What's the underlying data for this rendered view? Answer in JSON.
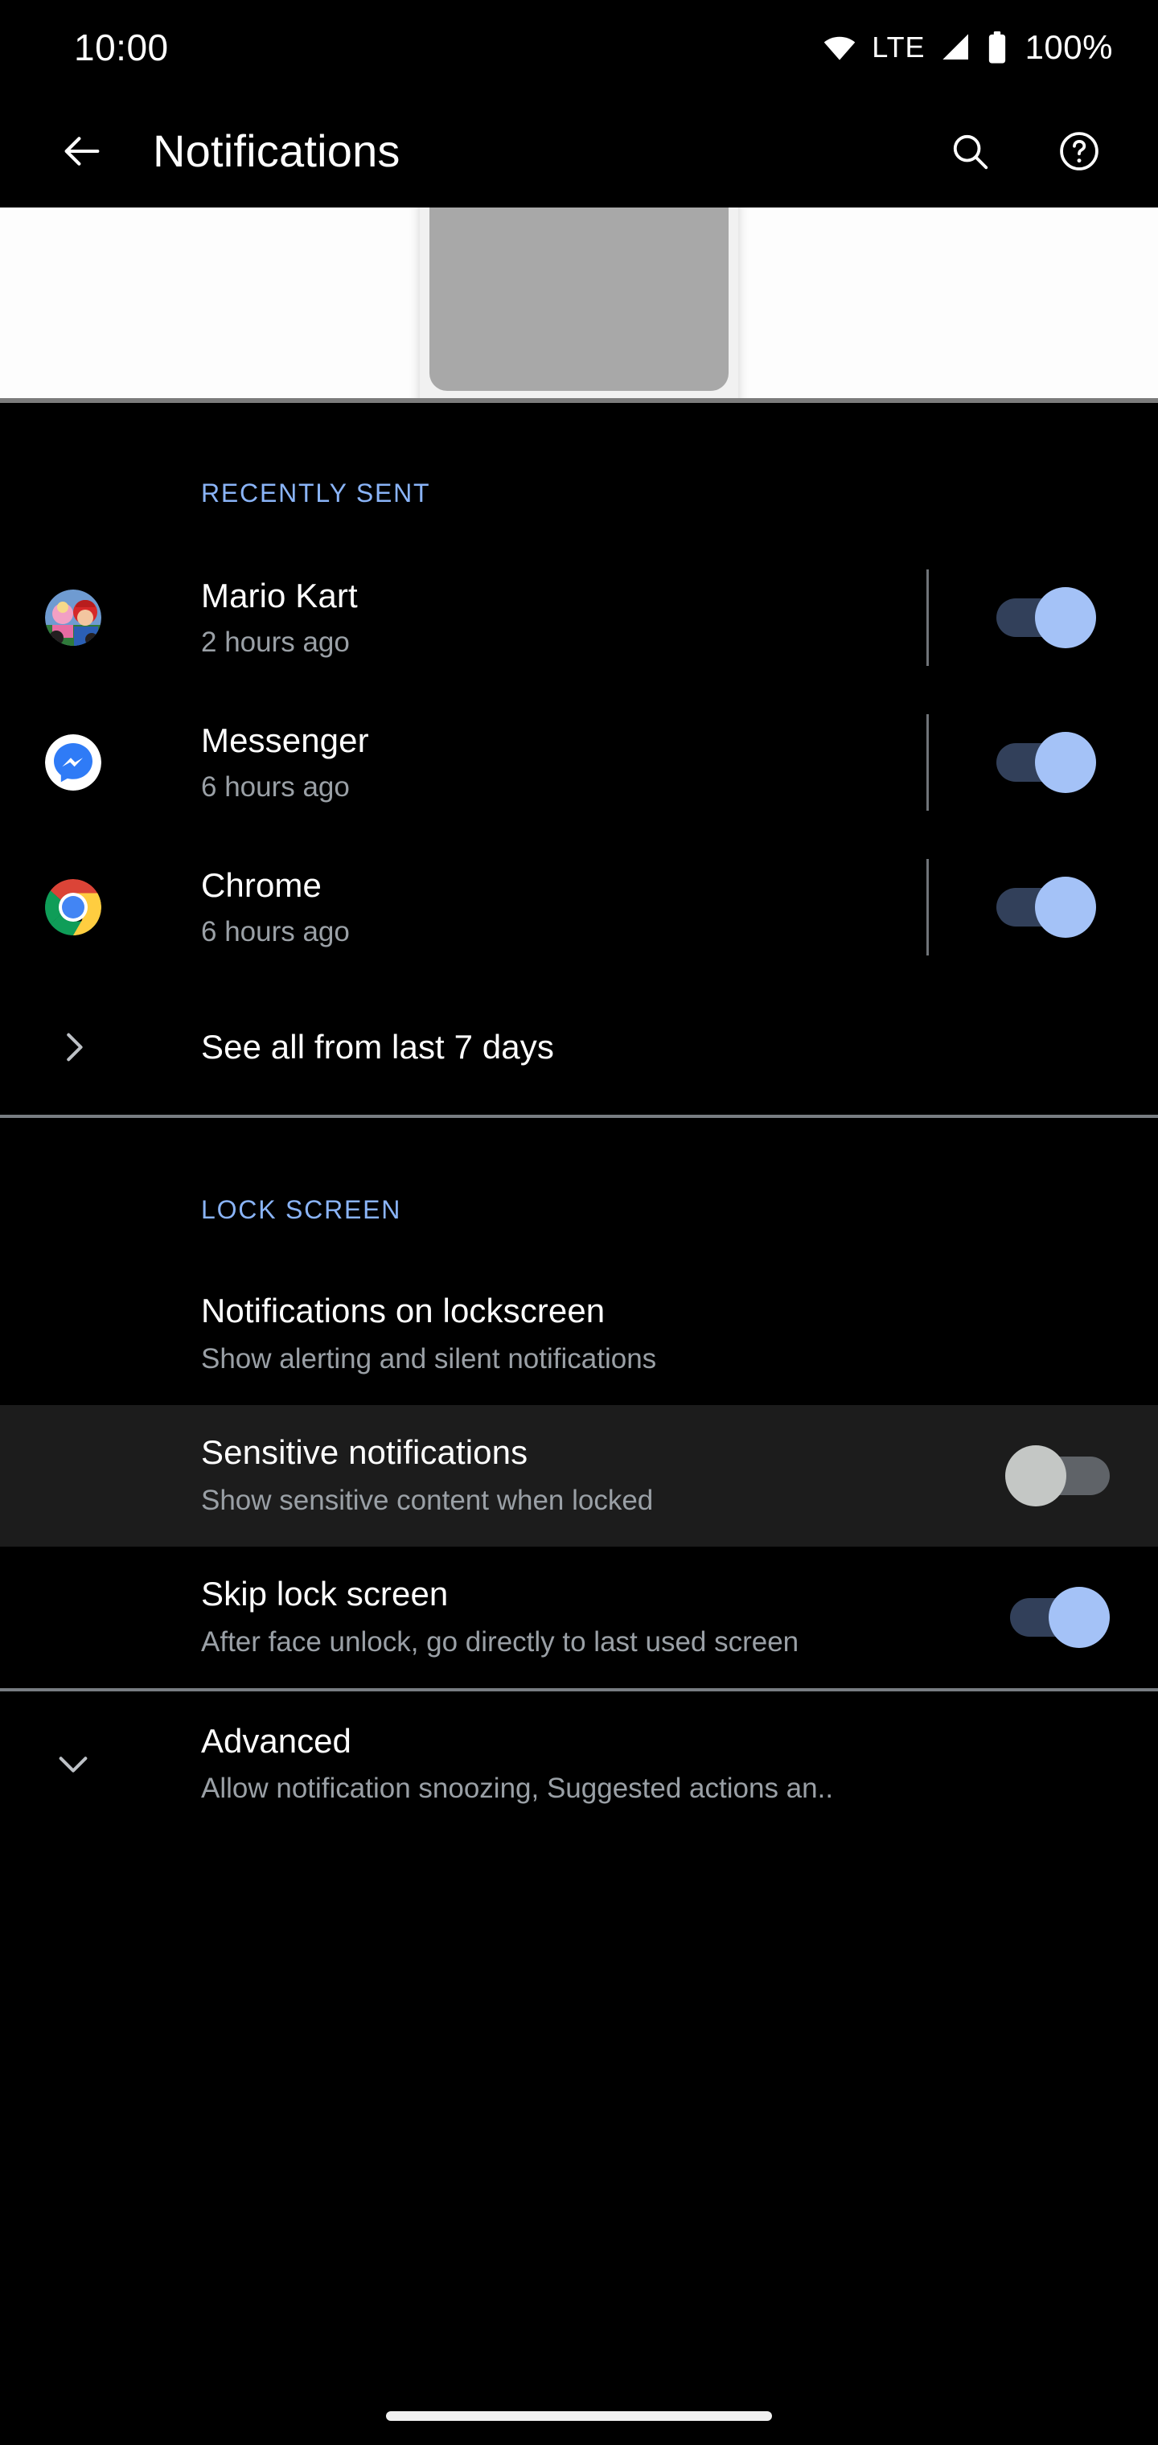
{
  "status_bar": {
    "time": "10:00",
    "network_label": "LTE",
    "battery_percent": "100%",
    "icons": {
      "wifi": "wifi-icon",
      "signal": "signal-bars-icon",
      "battery": "battery-full-icon"
    }
  },
  "app_bar": {
    "title": "Notifications",
    "back_icon": "arrow-back-icon",
    "search_icon": "search-icon",
    "help_icon": "help-circle-icon"
  },
  "hero": {
    "illustration": "phone-illustration"
  },
  "recently_sent": {
    "header": "RECENTLY SENT",
    "items": [
      {
        "name": "Mario Kart",
        "time": "2 hours ago",
        "icon": "mario-kart-icon",
        "toggle": "on"
      },
      {
        "name": "Messenger",
        "time": "6 hours ago",
        "icon": "messenger-icon",
        "toggle": "on"
      },
      {
        "name": "Chrome",
        "time": "6 hours ago",
        "icon": "chrome-icon",
        "toggle": "on"
      }
    ],
    "see_all_label": "See all from last 7 days",
    "see_all_icon": "chevron-right-icon"
  },
  "lock_screen": {
    "header": "LOCK SCREEN",
    "items": [
      {
        "title": "Notifications on lockscreen",
        "subtitle": "Show alerting and silent notifications",
        "has_toggle": false,
        "highlighted": false
      },
      {
        "title": "Sensitive notifications",
        "subtitle": "Show sensitive content when locked",
        "has_toggle": true,
        "toggle": "off",
        "highlighted": true
      },
      {
        "title": "Skip lock screen",
        "subtitle": "After face unlock, go directly to last used screen",
        "has_toggle": true,
        "toggle": "on",
        "highlighted": false
      }
    ]
  },
  "advanced": {
    "title": "Advanced",
    "subtitle": "Allow notification snoozing, Suggested actions an..",
    "icon": "chevron-down-icon"
  },
  "nav_bar": {
    "gesture_pill": "home-gesture-pill"
  },
  "colors": {
    "accent_blue": "#8ab4f8",
    "toggle_on_thumb": "#a4c2f7",
    "toggle_on_track": "#32405a",
    "toggle_off_thumb": "#c4c7c5",
    "toggle_off_track": "#5f6368",
    "background": "#000000",
    "highlight_row": "#1c1c1c",
    "secondary_text": "#9aa0a6"
  }
}
